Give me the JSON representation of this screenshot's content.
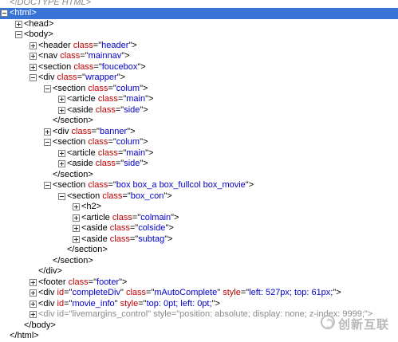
{
  "nodes": [
    {
      "depth": 0,
      "toggle": "none",
      "doctype": true,
      "parts": [
        {
          "c": "doctype",
          "t": "<!DOCTYPE HTML>"
        }
      ]
    },
    {
      "depth": 0,
      "toggle": "minus",
      "selected": true,
      "parts": [
        {
          "c": "tag",
          "t": "<html>"
        }
      ]
    },
    {
      "depth": 1,
      "toggle": "plus",
      "parts": [
        {
          "c": "tag",
          "t": "<head>"
        }
      ]
    },
    {
      "depth": 1,
      "toggle": "minus",
      "parts": [
        {
          "c": "tag",
          "t": "<body>"
        }
      ]
    },
    {
      "depth": 2,
      "toggle": "plus",
      "parts": [
        {
          "c": "tag",
          "t": "<header "
        },
        {
          "c": "attr",
          "t": "class"
        },
        {
          "c": "tag",
          "t": "=\""
        },
        {
          "c": "val",
          "t": "header"
        },
        {
          "c": "tag",
          "t": "\">"
        }
      ]
    },
    {
      "depth": 2,
      "toggle": "plus",
      "parts": [
        {
          "c": "tag",
          "t": "<nav "
        },
        {
          "c": "attr",
          "t": "class"
        },
        {
          "c": "tag",
          "t": "=\""
        },
        {
          "c": "val",
          "t": "mainnav"
        },
        {
          "c": "tag",
          "t": "\">"
        }
      ]
    },
    {
      "depth": 2,
      "toggle": "plus",
      "parts": [
        {
          "c": "tag",
          "t": "<section "
        },
        {
          "c": "attr",
          "t": "class"
        },
        {
          "c": "tag",
          "t": "=\""
        },
        {
          "c": "val",
          "t": "foucebox"
        },
        {
          "c": "tag",
          "t": "\">"
        }
      ]
    },
    {
      "depth": 2,
      "toggle": "minus",
      "parts": [
        {
          "c": "tag",
          "t": "<div "
        },
        {
          "c": "attr",
          "t": "class"
        },
        {
          "c": "tag",
          "t": "=\""
        },
        {
          "c": "val",
          "t": "wrapper"
        },
        {
          "c": "tag",
          "t": "\">"
        }
      ]
    },
    {
      "depth": 3,
      "toggle": "minus",
      "parts": [
        {
          "c": "tag",
          "t": "<section "
        },
        {
          "c": "attr",
          "t": "class"
        },
        {
          "c": "tag",
          "t": "=\""
        },
        {
          "c": "val",
          "t": "colum"
        },
        {
          "c": "tag",
          "t": "\">"
        }
      ]
    },
    {
      "depth": 4,
      "toggle": "plus",
      "parts": [
        {
          "c": "tag",
          "t": "<article "
        },
        {
          "c": "attr",
          "t": "class"
        },
        {
          "c": "tag",
          "t": "=\""
        },
        {
          "c": "val",
          "t": "main"
        },
        {
          "c": "tag",
          "t": "\">"
        }
      ]
    },
    {
      "depth": 4,
      "toggle": "plus",
      "parts": [
        {
          "c": "tag",
          "t": "<aside "
        },
        {
          "c": "attr",
          "t": "class"
        },
        {
          "c": "tag",
          "t": "=\""
        },
        {
          "c": "val",
          "t": "side"
        },
        {
          "c": "tag",
          "t": "\">"
        }
      ]
    },
    {
      "depth": 3,
      "toggle": "none",
      "parts": [
        {
          "c": "tag",
          "t": "</section>"
        }
      ]
    },
    {
      "depth": 3,
      "toggle": "plus",
      "parts": [
        {
          "c": "tag",
          "t": "<div "
        },
        {
          "c": "attr",
          "t": "class"
        },
        {
          "c": "tag",
          "t": "=\""
        },
        {
          "c": "val",
          "t": "banner"
        },
        {
          "c": "tag",
          "t": "\">"
        }
      ]
    },
    {
      "depth": 3,
      "toggle": "minus",
      "parts": [
        {
          "c": "tag",
          "t": "<section "
        },
        {
          "c": "attr",
          "t": "class"
        },
        {
          "c": "tag",
          "t": "=\""
        },
        {
          "c": "val",
          "t": "colum"
        },
        {
          "c": "tag",
          "t": "\">"
        }
      ]
    },
    {
      "depth": 4,
      "toggle": "plus",
      "parts": [
        {
          "c": "tag",
          "t": "<article "
        },
        {
          "c": "attr",
          "t": "class"
        },
        {
          "c": "tag",
          "t": "=\""
        },
        {
          "c": "val",
          "t": "main"
        },
        {
          "c": "tag",
          "t": "\">"
        }
      ]
    },
    {
      "depth": 4,
      "toggle": "plus",
      "parts": [
        {
          "c": "tag",
          "t": "<aside "
        },
        {
          "c": "attr",
          "t": "class"
        },
        {
          "c": "tag",
          "t": "=\""
        },
        {
          "c": "val",
          "t": "side"
        },
        {
          "c": "tag",
          "t": "\">"
        }
      ]
    },
    {
      "depth": 3,
      "toggle": "none",
      "parts": [
        {
          "c": "tag",
          "t": "</section>"
        }
      ]
    },
    {
      "depth": 3,
      "toggle": "minus",
      "parts": [
        {
          "c": "tag",
          "t": "<section "
        },
        {
          "c": "attr",
          "t": "class"
        },
        {
          "c": "tag",
          "t": "=\""
        },
        {
          "c": "val",
          "t": "box box_a box_fullcol box_movie"
        },
        {
          "c": "tag",
          "t": "\">"
        }
      ]
    },
    {
      "depth": 4,
      "toggle": "minus",
      "parts": [
        {
          "c": "tag",
          "t": "<section "
        },
        {
          "c": "attr",
          "t": "class"
        },
        {
          "c": "tag",
          "t": "=\""
        },
        {
          "c": "val",
          "t": "box_con"
        },
        {
          "c": "tag",
          "t": "\">"
        }
      ]
    },
    {
      "depth": 5,
      "toggle": "plus",
      "parts": [
        {
          "c": "tag",
          "t": "<h2>"
        }
      ]
    },
    {
      "depth": 5,
      "toggle": "plus",
      "parts": [
        {
          "c": "tag",
          "t": "<article "
        },
        {
          "c": "attr",
          "t": "class"
        },
        {
          "c": "tag",
          "t": "=\""
        },
        {
          "c": "val",
          "t": "colmain"
        },
        {
          "c": "tag",
          "t": "\">"
        }
      ]
    },
    {
      "depth": 5,
      "toggle": "plus",
      "parts": [
        {
          "c": "tag",
          "t": "<aside "
        },
        {
          "c": "attr",
          "t": "class"
        },
        {
          "c": "tag",
          "t": "=\""
        },
        {
          "c": "val",
          "t": "colside"
        },
        {
          "c": "tag",
          "t": "\">"
        }
      ]
    },
    {
      "depth": 5,
      "toggle": "plus",
      "parts": [
        {
          "c": "tag",
          "t": "<aside "
        },
        {
          "c": "attr",
          "t": "class"
        },
        {
          "c": "tag",
          "t": "=\""
        },
        {
          "c": "val",
          "t": "subtag"
        },
        {
          "c": "tag",
          "t": "\">"
        }
      ]
    },
    {
      "depth": 4,
      "toggle": "none",
      "parts": [
        {
          "c": "tag",
          "t": "</section>"
        }
      ]
    },
    {
      "depth": 3,
      "toggle": "none",
      "parts": [
        {
          "c": "tag",
          "t": "</section>"
        }
      ]
    },
    {
      "depth": 2,
      "toggle": "none",
      "parts": [
        {
          "c": "tag",
          "t": "</div>"
        }
      ]
    },
    {
      "depth": 2,
      "toggle": "plus",
      "parts": [
        {
          "c": "tag",
          "t": "<footer "
        },
        {
          "c": "attr",
          "t": "class"
        },
        {
          "c": "tag",
          "t": "=\""
        },
        {
          "c": "val",
          "t": "footer"
        },
        {
          "c": "tag",
          "t": "\">"
        }
      ]
    },
    {
      "depth": 2,
      "toggle": "plus",
      "parts": [
        {
          "c": "tag",
          "t": "<div "
        },
        {
          "c": "attr",
          "t": "id"
        },
        {
          "c": "tag",
          "t": "=\""
        },
        {
          "c": "val",
          "t": "completeDiv"
        },
        {
          "c": "tag",
          "t": "\" "
        },
        {
          "c": "attr",
          "t": "class"
        },
        {
          "c": "tag",
          "t": "=\""
        },
        {
          "c": "val",
          "t": "mAutoComplete"
        },
        {
          "c": "tag",
          "t": "\" "
        },
        {
          "c": "attr",
          "t": "style"
        },
        {
          "c": "tag",
          "t": "=\""
        },
        {
          "c": "val",
          "t": "left: 527px; top: 61px;"
        },
        {
          "c": "tag",
          "t": "\">"
        }
      ]
    },
    {
      "depth": 2,
      "toggle": "plus",
      "parts": [
        {
          "c": "tag",
          "t": "<div "
        },
        {
          "c": "attr",
          "t": "id"
        },
        {
          "c": "tag",
          "t": "=\""
        },
        {
          "c": "val",
          "t": "movie_info"
        },
        {
          "c": "tag",
          "t": "\" "
        },
        {
          "c": "attr",
          "t": "style"
        },
        {
          "c": "tag",
          "t": "=\""
        },
        {
          "c": "val",
          "t": "top: 0pt; left: 0pt;"
        },
        {
          "c": "tag",
          "t": "\">"
        }
      ]
    },
    {
      "depth": 2,
      "toggle": "plus",
      "gray": true,
      "parts": [
        {
          "c": "tag",
          "t": "<div "
        },
        {
          "c": "attr",
          "t": "id"
        },
        {
          "c": "tag",
          "t": "=\""
        },
        {
          "c": "val",
          "t": "livemargins_control"
        },
        {
          "c": "tag",
          "t": "\" "
        },
        {
          "c": "attr",
          "t": "style"
        },
        {
          "c": "tag",
          "t": "=\""
        },
        {
          "c": "val",
          "t": "position: absolute; display: none; z-index: 9999;"
        },
        {
          "c": "tag",
          "t": "\">"
        }
      ]
    },
    {
      "depth": 1,
      "toggle": "none",
      "parts": [
        {
          "c": "tag",
          "t": "</body>"
        }
      ]
    },
    {
      "depth": 0,
      "toggle": "none",
      "parts": [
        {
          "c": "tag",
          "t": "</html>"
        }
      ]
    }
  ],
  "watermark": {
    "text": "创新互联",
    "icon": "brand-logo-icon"
  }
}
